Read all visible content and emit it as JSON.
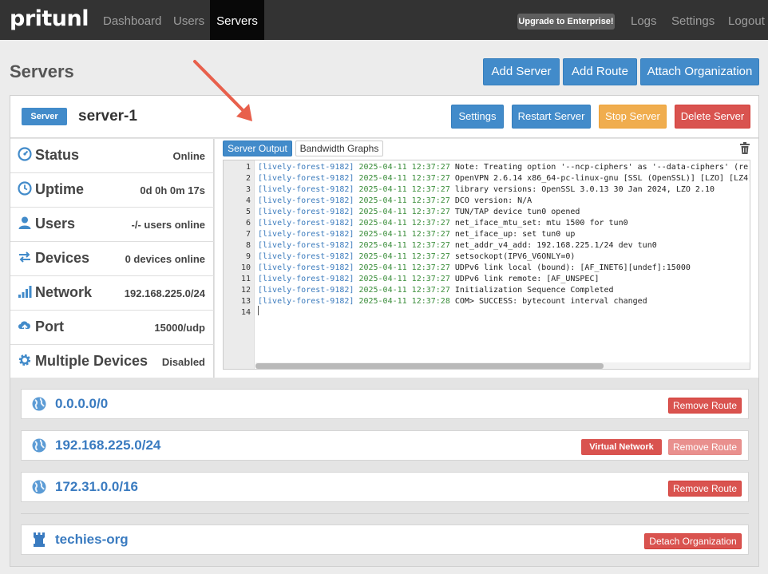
{
  "navbar": {
    "brand": "pritunl",
    "links": [
      "Dashboard",
      "Users",
      "Servers"
    ],
    "active": "Servers",
    "upgrade": "Upgrade to Enterprise!",
    "right_links": [
      "Logs",
      "Settings",
      "Logout"
    ]
  },
  "page": {
    "title": "Servers",
    "buttons": [
      "Add Server",
      "Add Route",
      "Attach Organization"
    ]
  },
  "server": {
    "label": "Server",
    "name": "server-1",
    "buttons": {
      "settings": "Settings",
      "restart": "Restart Server",
      "stop": "Stop Server",
      "delete": "Delete Server"
    },
    "info": [
      {
        "icon": "dashboard-icon",
        "label": "Status",
        "value": "Online"
      },
      {
        "icon": "clock-icon",
        "label": "Uptime",
        "value": "0d 0h 0m 17s"
      },
      {
        "icon": "user-icon",
        "label": "Users",
        "value": "-/- users online"
      },
      {
        "icon": "transfer-icon",
        "label": "Devices",
        "value": "0 devices online"
      },
      {
        "icon": "signal-icon",
        "label": "Network",
        "value": "192.168.225.0/24"
      },
      {
        "icon": "cloud-upload-icon",
        "label": "Port",
        "value": "15000/udp"
      },
      {
        "icon": "cog-icon",
        "label": "Multiple Devices",
        "value": "Disabled"
      }
    ],
    "tabs": {
      "output": "Server Output",
      "graphs": "Bandwidth Graphs"
    },
    "log": [
      {
        "n": "1",
        "host": "[lively-forest-9182]",
        "ts": "2025-04-11 12:37:27",
        "msg": "Note: Treating option '--ncp-ciphers' as  '--data-ciphers' (re"
      },
      {
        "n": "2",
        "host": "[lively-forest-9182]",
        "ts": "2025-04-11 12:37:27",
        "msg": "OpenVPN 2.6.14 x86_64-pc-linux-gnu [SSL (OpenSSL)] [LZO] [LZ4]"
      },
      {
        "n": "3",
        "host": "[lively-forest-9182]",
        "ts": "2025-04-11 12:37:27",
        "msg": "library versions: OpenSSL 3.0.13 30 Jan 2024, LZO 2.10"
      },
      {
        "n": "4",
        "host": "[lively-forest-9182]",
        "ts": "2025-04-11 12:37:27",
        "msg": "DCO version: N/A"
      },
      {
        "n": "5",
        "host": "[lively-forest-9182]",
        "ts": "2025-04-11 12:37:27",
        "msg": "TUN/TAP device tun0 opened"
      },
      {
        "n": "6",
        "host": "[lively-forest-9182]",
        "ts": "2025-04-11 12:37:27",
        "msg": "net_iface_mtu_set: mtu 1500 for tun0"
      },
      {
        "n": "7",
        "host": "[lively-forest-9182]",
        "ts": "2025-04-11 12:37:27",
        "msg": "net_iface_up: set tun0 up"
      },
      {
        "n": "8",
        "host": "[lively-forest-9182]",
        "ts": "2025-04-11 12:37:27",
        "msg": "net_addr_v4_add: 192.168.225.1/24 dev tun0"
      },
      {
        "n": "9",
        "host": "[lively-forest-9182]",
        "ts": "2025-04-11 12:37:27",
        "msg": "setsockopt(IPV6_V6ONLY=0)"
      },
      {
        "n": "10",
        "host": "[lively-forest-9182]",
        "ts": "2025-04-11 12:37:27",
        "msg": "UDPv6 link local (bound): [AF_INET6][undef]:15000"
      },
      {
        "n": "11",
        "host": "[lively-forest-9182]",
        "ts": "2025-04-11 12:37:27",
        "msg": "UDPv6 link remote: [AF_UNSPEC]"
      },
      {
        "n": "12",
        "host": "[lively-forest-9182]",
        "ts": "2025-04-11 12:37:27",
        "msg": "Initialization Sequence Completed"
      },
      {
        "n": "13",
        "host": "[lively-forest-9182]",
        "ts": "2025-04-11 12:37:28",
        "msg": "COM> SUCCESS: bytecount interval changed"
      },
      {
        "n": "14",
        "host": "",
        "ts": "",
        "msg": ""
      }
    ],
    "routes": [
      {
        "network": "0.0.0.0/0",
        "remove": "Remove Route",
        "virtual": ""
      },
      {
        "network": "192.168.225.0/24",
        "remove": "Remove Route",
        "virtual": "Virtual Network"
      },
      {
        "network": "172.31.0.0/16",
        "remove": "Remove Route",
        "virtual": ""
      }
    ],
    "organization": {
      "name": "techies-org",
      "detach": "Detach Organization"
    }
  },
  "colors": {
    "primary": "#428bca",
    "warning": "#f0ad4e",
    "danger": "#d9534f",
    "navbar": "#333333",
    "annotation_arrow": "#e8604c"
  }
}
